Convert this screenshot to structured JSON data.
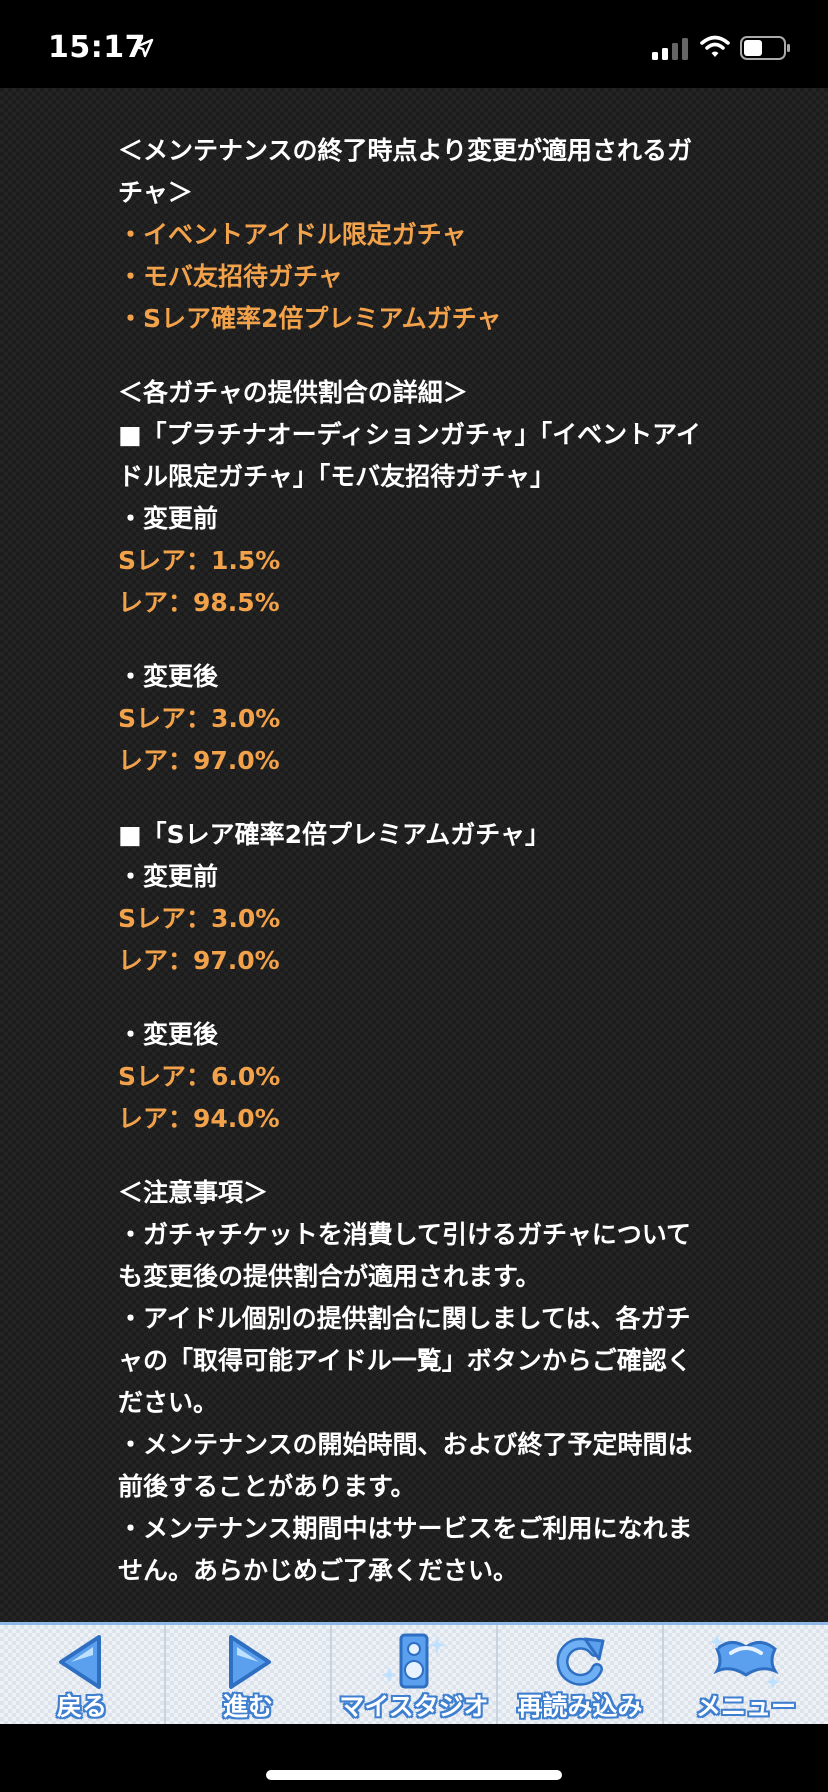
{
  "status": {
    "time": "15:17"
  },
  "lines": [
    {
      "text": "＜メンテナンスの終了時点より変更が適用されるガ",
      "color": "white"
    },
    {
      "text": "チャ＞",
      "color": "white"
    },
    {
      "text": "・イベントアイドル限定ガチャ",
      "color": "orange"
    },
    {
      "text": "・モバ友招待ガチャ",
      "color": "orange"
    },
    {
      "text": "・Sレア確率2倍プレミアムガチャ",
      "color": "orange"
    },
    {
      "text": "",
      "color": "gap"
    },
    {
      "text": "＜各ガチャの提供割合の詳細＞",
      "color": "white"
    },
    {
      "text": "■「プラチナオーディションガチャ」「イベントアイ",
      "color": "white"
    },
    {
      "text": "ドル限定ガチャ」「モバ友招待ガチャ」",
      "color": "white"
    },
    {
      "text": "・変更前",
      "color": "white"
    },
    {
      "text": "Sレア：1.5%",
      "color": "orange"
    },
    {
      "text": "レア：98.5%",
      "color": "orange"
    },
    {
      "text": "",
      "color": "gap"
    },
    {
      "text": "・変更後",
      "color": "white"
    },
    {
      "text": "Sレア：3.0%",
      "color": "orange"
    },
    {
      "text": "レア：97.0%",
      "color": "orange"
    },
    {
      "text": "",
      "color": "gap"
    },
    {
      "text": "■「Sレア確率2倍プレミアムガチャ」",
      "color": "white"
    },
    {
      "text": "・変更前",
      "color": "white"
    },
    {
      "text": "Sレア：3.0%",
      "color": "orange"
    },
    {
      "text": "レア：97.0%",
      "color": "orange"
    },
    {
      "text": "",
      "color": "gap"
    },
    {
      "text": "・変更後",
      "color": "white"
    },
    {
      "text": "Sレア：6.0%",
      "color": "orange"
    },
    {
      "text": "レア：94.0%",
      "color": "orange"
    },
    {
      "text": "",
      "color": "gap"
    },
    {
      "text": "＜注意事項＞",
      "color": "white"
    },
    {
      "text": "・ガチャチケットを消費して引けるガチャについて",
      "color": "white"
    },
    {
      "text": "も変更後の提供割合が適用されます。",
      "color": "white"
    },
    {
      "text": "・アイドル個別の提供割合に関しましては、各ガチ",
      "color": "white"
    },
    {
      "text": "ャの「取得可能アイドル一覧」ボタンからご確認く",
      "color": "white"
    },
    {
      "text": "ださい。",
      "color": "white"
    },
    {
      "text": "・メンテナンスの開始時間、および終了予定時間は",
      "color": "white"
    },
    {
      "text": "前後することがあります。",
      "color": "white"
    },
    {
      "text": "・メンテナンス期間中はサービスをご利用になれま",
      "color": "white"
    },
    {
      "text": "せん。あらかじめご了承ください。",
      "color": "white"
    }
  ],
  "colors": {
    "white": "#ffffff",
    "orange": "#f2a24a",
    "nav_blue": "#3f7fd0"
  },
  "nav": [
    {
      "label": "戻る",
      "icon": "back-arrow-icon"
    },
    {
      "label": "進む",
      "icon": "forward-arrow-icon"
    },
    {
      "label": "マイスタジオ",
      "icon": "speaker-icon"
    },
    {
      "label": "再読み込み",
      "icon": "reload-icon"
    },
    {
      "label": "メニュー",
      "icon": "menu-logo-icon"
    }
  ]
}
